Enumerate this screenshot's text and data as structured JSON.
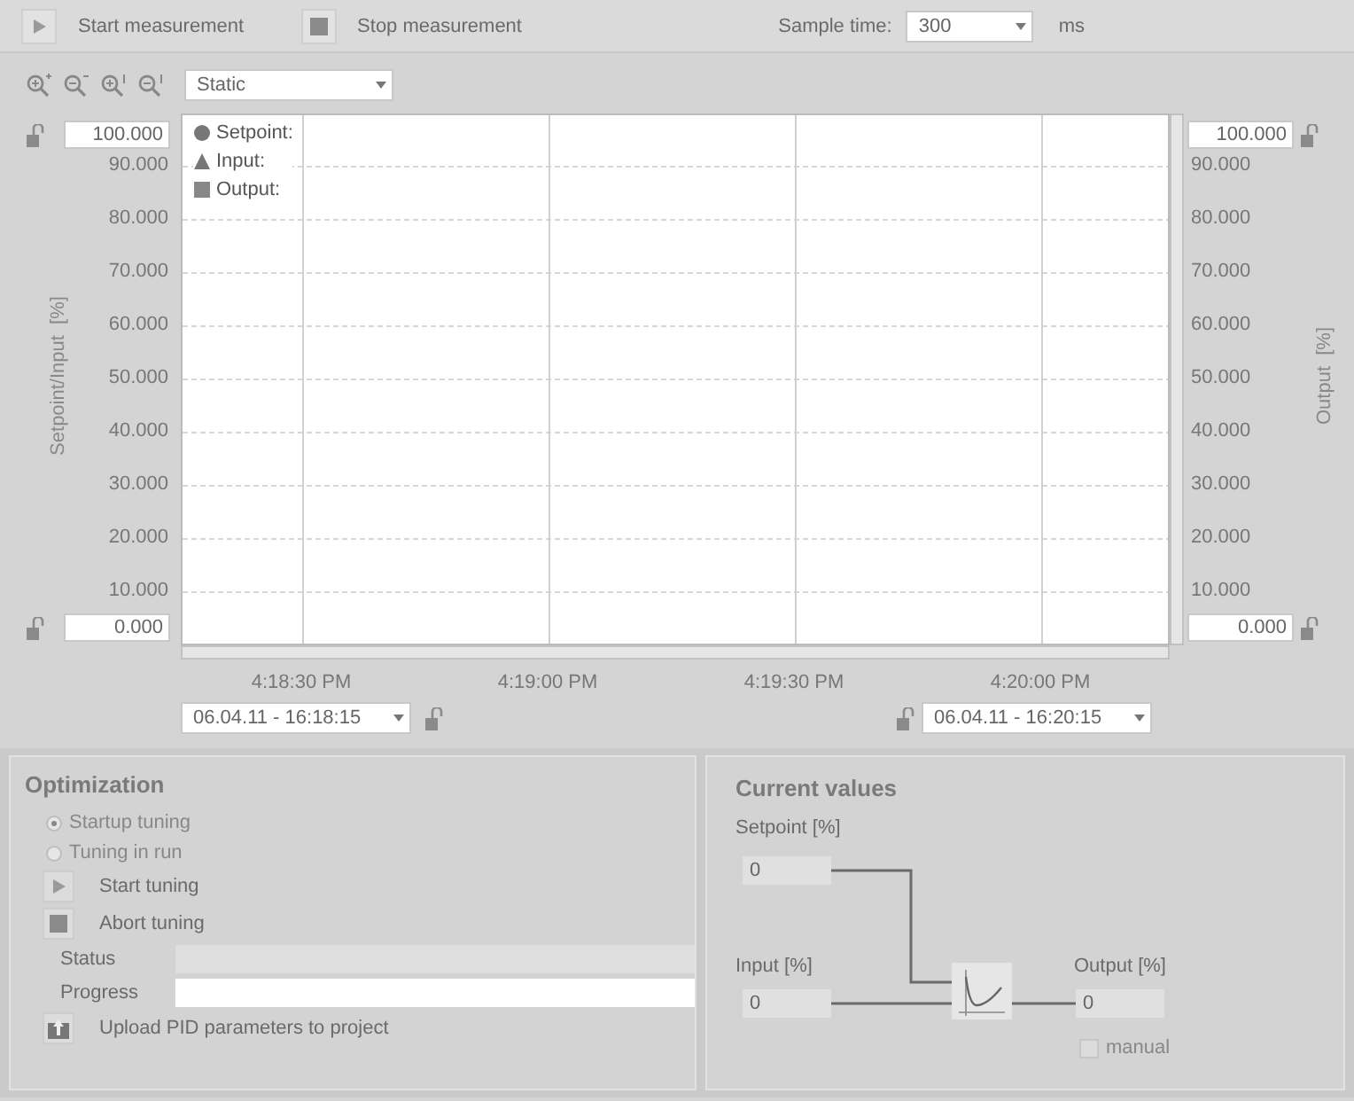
{
  "toolbar": {
    "start_button": "Start measurement",
    "stop_button": "Stop measurement",
    "sample_time": {
      "label": "Sample time:",
      "value": "300",
      "unit": "ms"
    }
  },
  "chart_toolbar": {
    "view_mode": "Static"
  },
  "trend": {
    "legend": [
      {
        "label": "Setpoint:",
        "kind": "circle"
      },
      {
        "label": "Input:",
        "kind": "triangle"
      },
      {
        "label": "Output:",
        "kind": "square"
      }
    ],
    "left_axis": {
      "title": "Setpoint/Input  [%]",
      "max": "100.000",
      "min": "0.000",
      "ticks": [
        "90.000",
        "80.000",
        "70.000",
        "60.000",
        "50.000",
        "40.000",
        "30.000",
        "20.000",
        "10.000"
      ]
    },
    "right_axis": {
      "title": "Output  [%]",
      "max": "100.000",
      "min": "0.000",
      "ticks": [
        "90.000",
        "80.000",
        "70.000",
        "60.000",
        "50.000",
        "40.000",
        "30.000",
        "20.000",
        "10.000"
      ]
    },
    "time_ticks": [
      "4:18:30 PM",
      "4:19:00 PM",
      "4:19:30 PM",
      "4:20:00 PM"
    ],
    "start_time": "06.04.11 - 16:18:15",
    "end_time": "06.04.11 - 16:20:15"
  },
  "optimization": {
    "title": "Optimization",
    "modes": [
      {
        "label": "Startup tuning",
        "selected": true,
        "disabled": true
      },
      {
        "label": "Tuning in run",
        "selected": false,
        "disabled": true
      }
    ],
    "start_button": "Start tuning",
    "abort_button": "Abort tuning",
    "status_label": "Status",
    "progress": {
      "label": "Progress",
      "level": 0
    },
    "upload_button": "Upload PID parameters to project"
  },
  "current_values": {
    "title": "Current values",
    "setpoint": {
      "label": "Setpoint [%]",
      "value": "0"
    },
    "input": {
      "label": "Input [%]",
      "value": "0"
    },
    "output": {
      "label": "Output [%]",
      "value": "0"
    },
    "manual": {
      "label": "manual",
      "checked": false,
      "disabled": true
    }
  }
}
